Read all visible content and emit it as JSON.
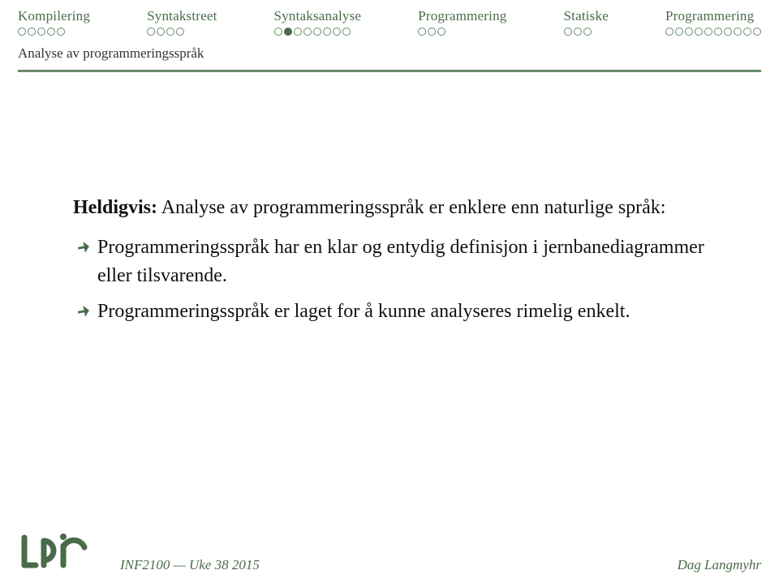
{
  "nav": {
    "items": [
      {
        "label": "Kompilering",
        "dots": 5,
        "current": -1
      },
      {
        "label": "Syntakstreet",
        "dots": 4,
        "current": -1
      },
      {
        "label": "Syntaksanalyse",
        "dots": 8,
        "current": 1
      },
      {
        "label": "Programmering",
        "dots": 3,
        "current": -1
      },
      {
        "label": "Statiske",
        "dots": 3,
        "current": -1
      },
      {
        "label": "Programmering",
        "dots": 10,
        "current": -1
      }
    ]
  },
  "subsection": {
    "title": "Analyse av programmeringsspråk"
  },
  "content": {
    "lead_bold": "Heldigvis:",
    "lead_rest": " Analyse av programmeringsspråk er enklere enn naturlige språk:",
    "bullets": [
      "Programmeringsspråk har en klar og entydig definisjon i jernbanediagrammer eller tilsvarende.",
      "Programmeringsspråk er laget for å kunne analyseres rimelig enkelt."
    ]
  },
  "footer": {
    "course": "INF2100 — Uke 38 2015",
    "author": "Dag Langmyhr"
  }
}
